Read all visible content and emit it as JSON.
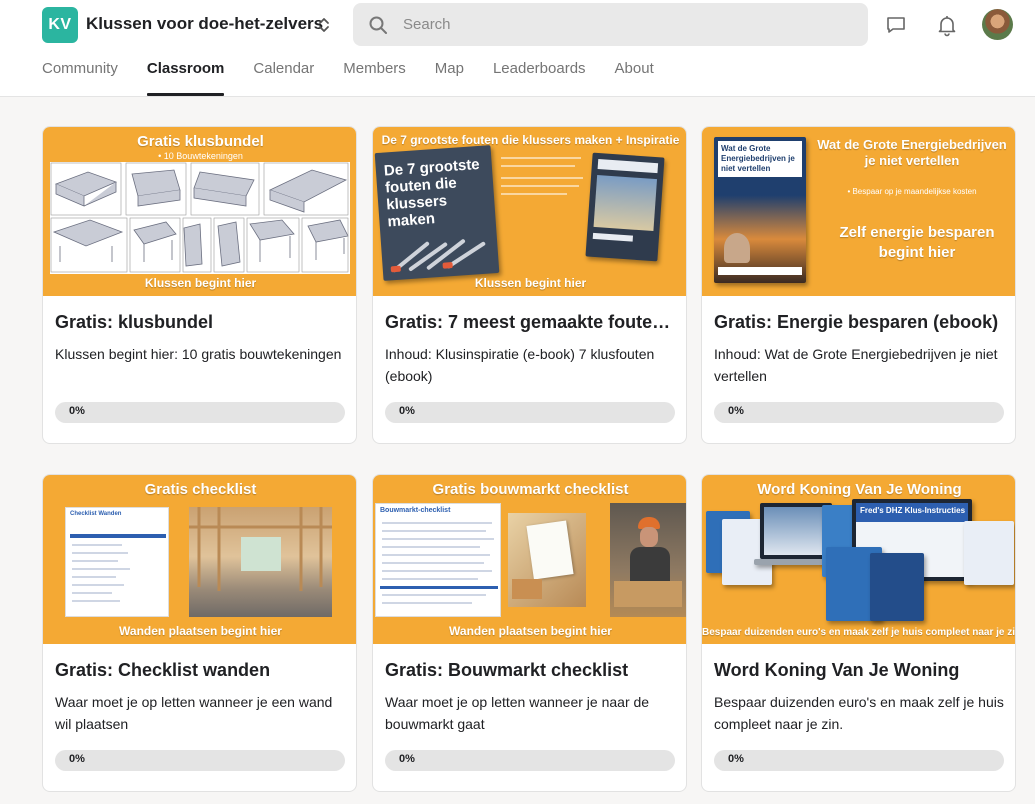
{
  "header": {
    "logo_text": "KV",
    "group_name": "Klussen voor doe-het-zelvers",
    "search_placeholder": "Search",
    "icons": [
      "chevron-updown-icon",
      "search-icon",
      "chat-icon",
      "bell-icon",
      "avatar"
    ]
  },
  "tabs": [
    {
      "label": "Community",
      "active": false
    },
    {
      "label": "Classroom",
      "active": true
    },
    {
      "label": "Calendar",
      "active": false
    },
    {
      "label": "Members",
      "active": false
    },
    {
      "label": "Map",
      "active": false
    },
    {
      "label": "Leaderboards",
      "active": false
    },
    {
      "label": "About",
      "active": false
    }
  ],
  "colors": {
    "brand": "#2bb5a0",
    "thumbnail_bg": "#f4a934",
    "progress_track": "#e4e4e4",
    "active_tab": "#202124"
  },
  "courses": [
    {
      "title": "Gratis: klusbundel",
      "description": "Klussen begint hier: 10 gratis bouwtekeningen",
      "progress_label": "0%",
      "progress": 0,
      "thumb": {
        "title": "Gratis klusbundel",
        "subtitle": "• 10 Bouwtekeningen",
        "footer": "Klussen begint hier"
      }
    },
    {
      "title": "Gratis: 7 meest gemaakte fouten ...",
      "description": "Inhoud: Klusinspiratie (e-book) 7 klusfouten (ebook)",
      "progress_label": "0%",
      "progress": 0,
      "thumb": {
        "title": "De 7 grootste fouten die klussers maken + Inspiratie",
        "book_text": "De 7 grootste fouten die klussers maken",
        "footer": "Klussen begint hier"
      }
    },
    {
      "title": "Gratis: Energie besparen (ebook)",
      "description": "Inhoud: Wat de Grote Energiebedrijven je niet vertellen",
      "progress_label": "0%",
      "progress": 0,
      "thumb": {
        "title": "Wat de Grote Energiebedrijven je niet vertellen",
        "bullet": "• Bespaar op je maandelijkse kosten",
        "headline": "Zelf energie besparen begint hier",
        "book_text": "Wat de Grote Energiebedrijven je niet vertellen"
      }
    },
    {
      "title": "Gratis: Checklist wanden",
      "description": "Waar moet je op letten wanneer je een wand wil plaatsen",
      "progress_label": "0%",
      "progress": 0,
      "thumb": {
        "title": "Gratis checklist",
        "doc_heading": "Checklist Wanden",
        "footer": "Wanden plaatsen begint hier"
      }
    },
    {
      "title": "Gratis: Bouwmarkt checklist",
      "description": "Waar moet je op letten wanneer je naar de bouwmarkt gaat",
      "progress_label": "0%",
      "progress": 0,
      "thumb": {
        "title": "Gratis bouwmarkt checklist",
        "doc_heading": "Bouwmarkt-checklist",
        "footer": "Wanden plaatsen begint hier"
      }
    },
    {
      "title": "Word Koning Van Je Woning",
      "description": "Bespaar duizenden euro's en maak zelf je huis compleet naar je zin.",
      "progress_label": "0%",
      "progress": 0,
      "thumb": {
        "title": "Word Koning Van Je Woning",
        "screen_text": "Fred's DHZ Klus-Instructies",
        "footer": "Bespaar duizenden euro's en maak zelf je huis compleet naar je zin."
      }
    }
  ]
}
